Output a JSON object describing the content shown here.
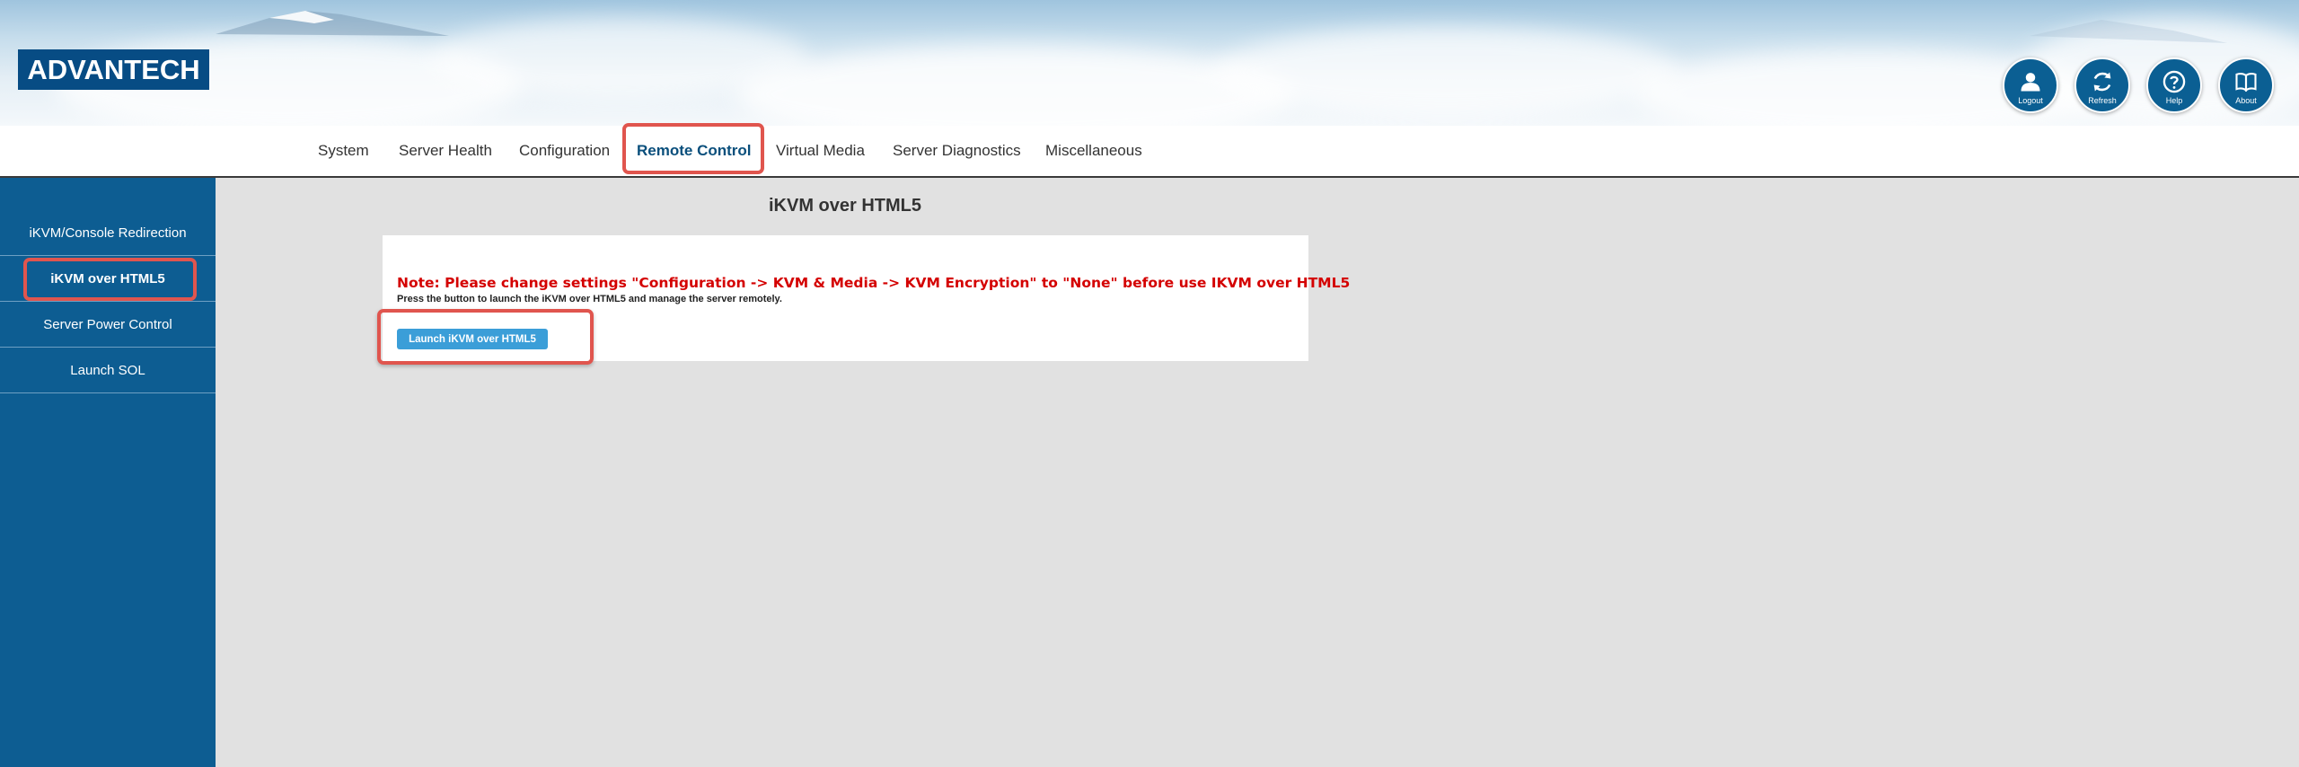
{
  "header": {
    "logo_text": "ADVANTECH",
    "buttons": [
      {
        "label": "Logout",
        "icon": "user-icon"
      },
      {
        "label": "Refresh",
        "icon": "refresh-icon"
      },
      {
        "label": "Help",
        "icon": "question-icon"
      },
      {
        "label": "About",
        "icon": "book-icon"
      }
    ]
  },
  "topnav": {
    "items": [
      "System",
      "Server Health",
      "Configuration",
      "Remote Control",
      "Virtual Media",
      "Server Diagnostics",
      "Miscellaneous"
    ],
    "active": "Remote Control"
  },
  "sidebar": {
    "items": [
      "iKVM/Console Redirection",
      "iKVM over HTML5",
      "Server Power Control",
      "Launch SOL"
    ],
    "active": "iKVM over HTML5"
  },
  "main": {
    "title": "iKVM over HTML5",
    "note": "Note: Please change settings \"Configuration -> KVM & Media -> KVM Encryption\" to \"None\" before use IKVM over HTML5",
    "description": "Press the button to launch the iKVM over HTML5 and manage the server remotely.",
    "launch_button": "Launch iKVM over HTML5"
  },
  "colors": {
    "brand_blue": "#074c84",
    "sidebar_blue": "#0d5d92",
    "highlight_red": "#e0554e",
    "note_red": "#d40000",
    "button_blue": "#3b9ed8"
  }
}
